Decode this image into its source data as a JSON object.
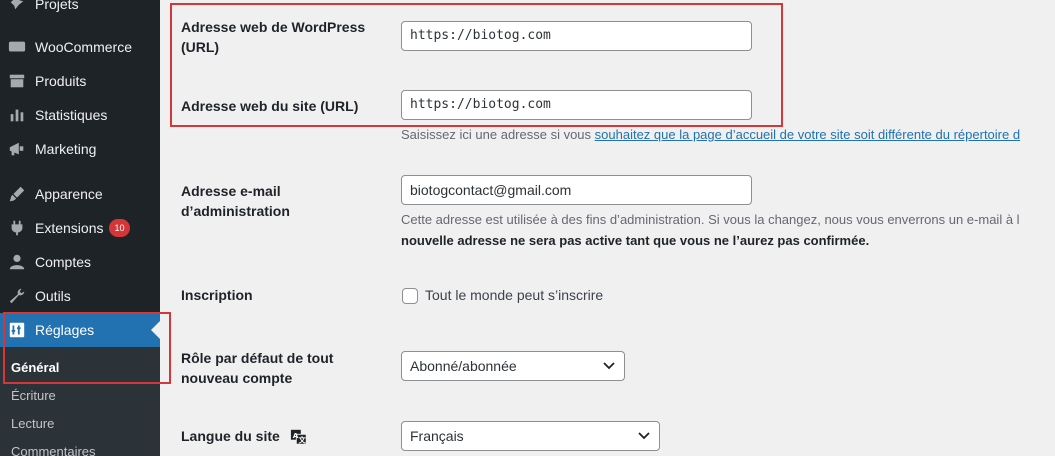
{
  "sidebar": {
    "items": [
      {
        "label": "Projets",
        "icon": "pin-icon"
      },
      {
        "label": "WooCommerce",
        "icon": "woocommerce-icon"
      },
      {
        "label": "Produits",
        "icon": "products-icon"
      },
      {
        "label": "Statistiques",
        "icon": "stats-icon"
      },
      {
        "label": "Marketing",
        "icon": "megaphone-icon"
      },
      {
        "label": "Apparence",
        "icon": "brush-icon"
      },
      {
        "label": "Extensions",
        "icon": "plugin-icon",
        "badge": "10"
      },
      {
        "label": "Comptes",
        "icon": "user-icon"
      },
      {
        "label": "Outils",
        "icon": "wrench-icon"
      },
      {
        "label": "Réglages",
        "icon": "settings-icon"
      }
    ],
    "submenu": [
      "Général",
      "Écriture",
      "Lecture",
      "Commentaires"
    ]
  },
  "form": {
    "wp_url_label": "Adresse web de WordPress (URL)",
    "wp_url_value": "https://biotog.com",
    "site_url_label": "Adresse web du site (URL)",
    "site_url_value": "https://biotog.com",
    "site_url_desc_prefix": "Saisissez ici une adresse si vous ",
    "site_url_desc_link": "souhaitez que la page d’accueil de votre site soit différente du répertoire d",
    "email_label": "Adresse e-mail d’administration",
    "email_value": "biotogcontact@gmail.com",
    "email_desc_line1": "Cette adresse est utilisée à des fins d’administration. Si vous la changez, nous vous enverrons un e-mail à l",
    "email_desc_line2": "nouvelle adresse ne sera pas active tant que vous ne l’aurez pas confirmée.",
    "signup_label": "Inscription",
    "signup_checkbox_label": "Tout le monde peut s’inscrire",
    "role_label": "Rôle par défaut de tout nouveau compte",
    "role_value": "Abonné/abonnée",
    "language_label": "Langue du site",
    "language_value": "Français"
  },
  "colors": {
    "accent": "#2271b1",
    "highlight": "#d63638"
  }
}
